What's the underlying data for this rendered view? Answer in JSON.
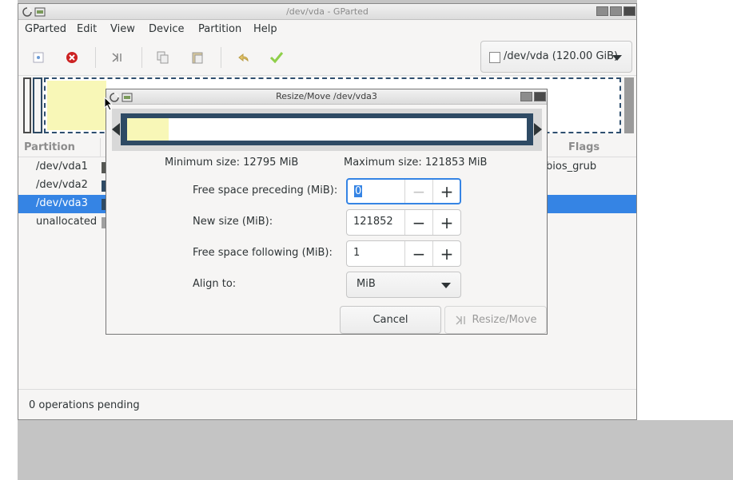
{
  "main_window": {
    "title": "/dev/vda - GParted",
    "menu": [
      "GParted",
      "Edit",
      "View",
      "Device",
      "Partition",
      "Help"
    ],
    "device_selector": "/dev/vda (120.00 GiB)",
    "columns": {
      "partition": "Partition",
      "flags": "Flags"
    },
    "partitions": [
      {
        "name": "/dev/vda1",
        "flags": "bios_grub",
        "color": "#555753"
      },
      {
        "name": "/dev/vda2",
        "flags": "",
        "color": "#2e4a64"
      },
      {
        "name": "/dev/vda3",
        "flags": "",
        "color": "#2e4a64",
        "selected": true
      },
      {
        "name": "unallocated",
        "flags": "",
        "color": "#a0a0a0"
      }
    ],
    "status": "0 operations pending"
  },
  "dialog": {
    "title": "Resize/Move /dev/vda3",
    "min_size": "Minimum size: 12795 MiB",
    "max_size": "Maximum size: 121853 MiB",
    "fields": [
      {
        "label": "Free space preceding (MiB):",
        "value": "0"
      },
      {
        "label": "New size (MiB):",
        "value": "121852"
      },
      {
        "label": "Free space following (MiB):",
        "value": "1"
      }
    ],
    "align_label": "Align to:",
    "align_value": "MiB",
    "cancel_label": "Cancel",
    "resize_label": "Resize/Move"
  },
  "colors": {
    "accent": "#3584e4",
    "used_space": "#f8f7b7",
    "partition_frame": "#2e4a64"
  },
  "icons": [
    "new-icon",
    "delete-icon",
    "resize-icon",
    "copy-icon",
    "paste-icon",
    "undo-icon",
    "apply-icon",
    "close-icon",
    "drive-icon"
  ]
}
